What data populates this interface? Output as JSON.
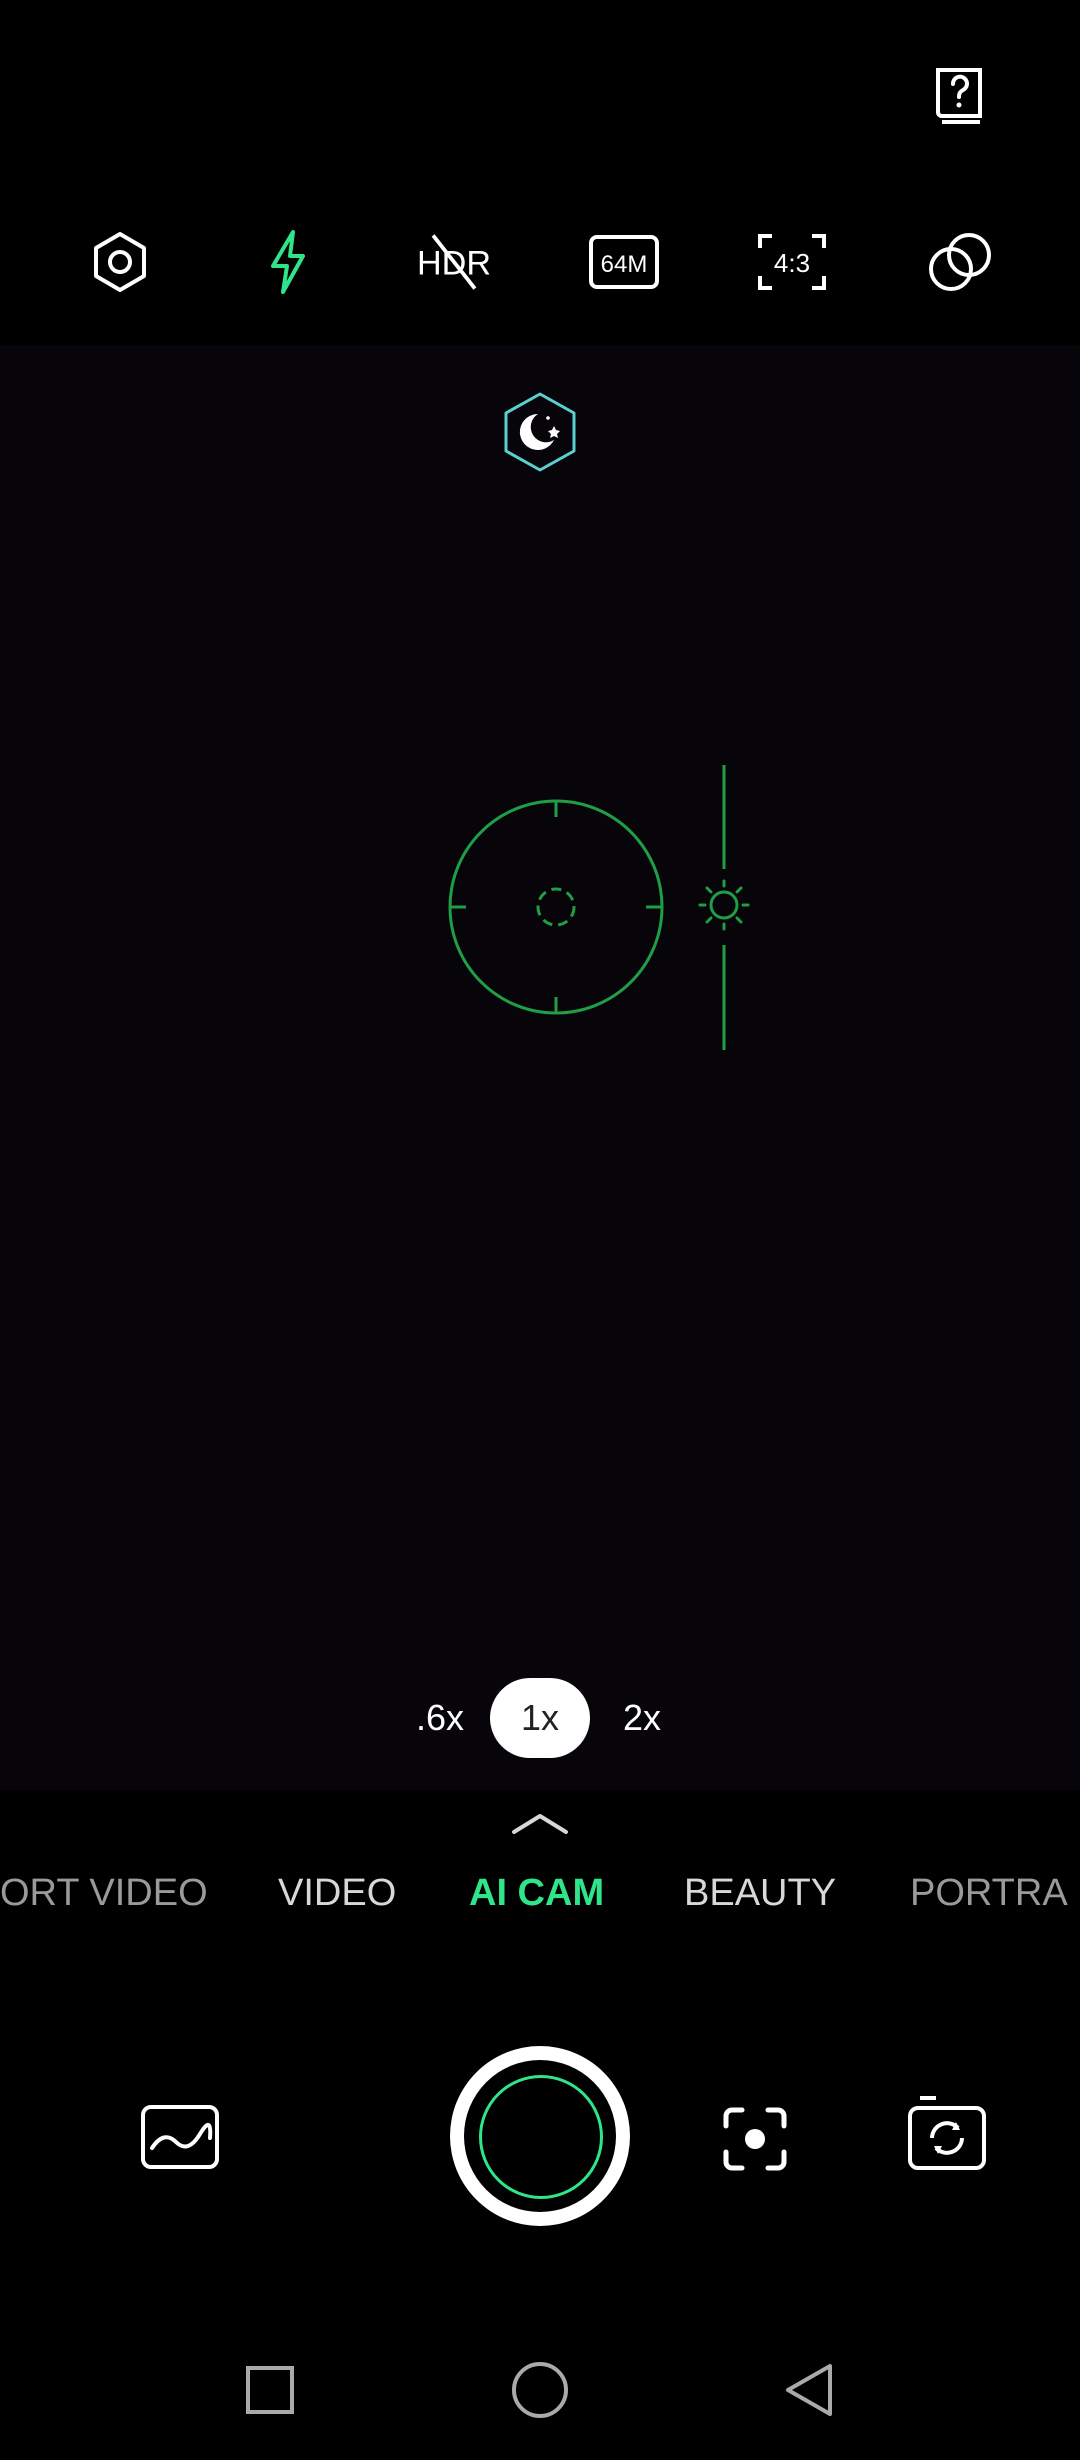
{
  "top_bar": {
    "icons": {
      "help": "help-book-icon",
      "settings": "settings-hex-icon",
      "flash": "flash-icon",
      "hdr": "hdr-off-icon",
      "resolution": "64m-resolution-icon",
      "aspect": "aspect-ratio-icon",
      "filters": "filters-icon"
    },
    "hdr_label": "HDR",
    "resolution_label": "64M",
    "aspect_label": "4:3"
  },
  "viewfinder": {
    "scene_icon": "night-scene-icon",
    "focus_icon": "focus-ring-icon",
    "exposure_icon": "exposure-sun-icon"
  },
  "zoom": {
    "options": [
      ".6x",
      "1x",
      "2x"
    ],
    "selected": "1x"
  },
  "modes": {
    "items": [
      "PORTRAIT VIDEO",
      "VIDEO",
      "AI CAM",
      "BEAUTY",
      "PORTRAIT"
    ],
    "visible_text": [
      "ORT VIDEO",
      "VIDEO",
      "AI CAM",
      "BEAUTY",
      "PORTRA"
    ],
    "active": "AI CAM"
  },
  "bottom": {
    "gallery_icon": "gallery-thumbnail-icon",
    "shutter_icon": "shutter-button",
    "lens_icon": "google-lens-icon",
    "flip_icon": "flip-camera-icon"
  },
  "nav": {
    "recents_icon": "recents-square-icon",
    "home_icon": "home-circle-icon",
    "back_icon": "back-triangle-icon"
  },
  "colors": {
    "accent": "#2EE58A",
    "focus_green": "#1F9E45",
    "badge_teal": "#5BCFD0",
    "text": "#D8D8D8",
    "viewfinder_bg": "#07050A"
  }
}
